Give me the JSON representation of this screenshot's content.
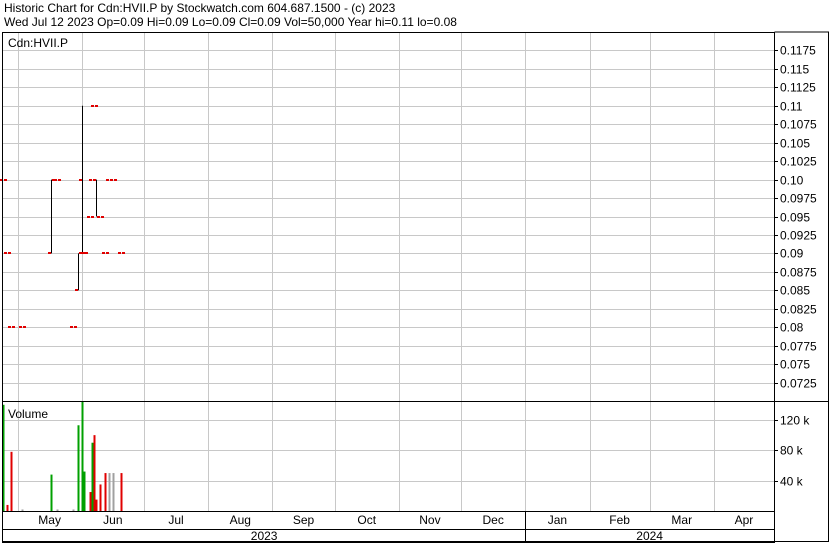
{
  "header": {
    "line1": "Historic Chart for Cdn:HVII.P by Stockwatch.com 604.687.1500 - (c) 2023",
    "line2": "Wed Jul 12 2023  Op=0.09  Hi=0.09  Lo=0.09  Cl=0.09  Vol=50,000  Year hi=0.11  lo=0.08"
  },
  "chart_data": {
    "type": "bar",
    "symbol_label": "Cdn:HVII.P",
    "volume_label": "Volume",
    "price_axis": {
      "range": [
        0.07,
        0.12
      ],
      "ticks": [
        "0.1175",
        "0.115",
        "0.1125",
        "0.11",
        "0.1075",
        "0.105",
        "0.1025",
        "0.10",
        "0.0975",
        "0.095",
        "0.0925",
        "0.09",
        "0.0875",
        "0.085",
        "0.0825",
        "0.08",
        "0.0775",
        "0.075",
        "0.0725"
      ]
    },
    "volume_axis": {
      "range": [
        0,
        145000
      ],
      "ticks": [
        {
          "label": "120 k",
          "value": 120000
        },
        {
          "label": "80 k",
          "value": 80000
        },
        {
          "label": "40 k",
          "value": 40000
        }
      ]
    },
    "x_range": [
      "2023-04-24",
      "2024-04-30"
    ],
    "months": [
      {
        "label": "May",
        "date": "2023-05-01"
      },
      {
        "label": "Jun",
        "date": "2023-06-01"
      },
      {
        "label": "Jul",
        "date": "2023-07-01"
      },
      {
        "label": "Aug",
        "date": "2023-08-01"
      },
      {
        "label": "Sep",
        "date": "2023-09-01"
      },
      {
        "label": "Oct",
        "date": "2023-10-01"
      },
      {
        "label": "Nov",
        "date": "2023-11-01"
      },
      {
        "label": "Dec",
        "date": "2023-12-01"
      },
      {
        "label": "Jan",
        "date": "2024-01-01"
      },
      {
        "label": "Feb",
        "date": "2024-02-01"
      },
      {
        "label": "Mar",
        "date": "2024-03-01"
      },
      {
        "label": "Apr",
        "date": "2024-04-01"
      }
    ],
    "years": [
      {
        "label": "2023",
        "from": "2023-04-24",
        "to": "2024-01-01"
      },
      {
        "label": "2024",
        "from": "2024-01-01",
        "to": "2024-04-30"
      }
    ],
    "bars": [
      {
        "date": "2023-04-24",
        "open": 0.1,
        "high": 0.1,
        "low": 0.1,
        "close": 0.1,
        "volume": 140000,
        "direction": "up"
      },
      {
        "date": "2023-04-26",
        "open": 0.09,
        "high": 0.09,
        "low": 0.09,
        "close": 0.09,
        "volume": 8000,
        "direction": "down"
      },
      {
        "date": "2023-04-28",
        "open": 0.08,
        "high": 0.08,
        "low": 0.08,
        "close": 0.08,
        "volume": 78000,
        "direction": "down"
      },
      {
        "date": "2023-05-03",
        "open": 0.08,
        "high": 0.08,
        "low": 0.08,
        "close": 0.08,
        "volume": 2000,
        "direction": "flat"
      },
      {
        "date": "2023-05-17",
        "open": 0.09,
        "high": 0.1,
        "low": 0.09,
        "close": 0.1,
        "volume": 48000,
        "direction": "up"
      },
      {
        "date": "2023-05-20",
        "open": 0.1,
        "high": 0.1,
        "low": 0.1,
        "close": 0.1,
        "volume": 2000,
        "direction": "flat"
      },
      {
        "date": "2023-05-28",
        "open": 0.08,
        "high": 0.08,
        "low": 0.08,
        "close": 0.08,
        "volume": 2000,
        "direction": "flat"
      },
      {
        "date": "2023-05-30",
        "open": 0.085,
        "high": 0.09,
        "low": 0.085,
        "close": 0.09,
        "volume": 113000,
        "direction": "up"
      },
      {
        "date": "2023-06-01",
        "open": 0.1,
        "high": 0.11,
        "low": 0.09,
        "close": 0.09,
        "volume": 145000,
        "direction": "up"
      },
      {
        "date": "2023-06-02",
        "open": 0.09,
        "high": 0.09,
        "low": 0.09,
        "close": 0.09,
        "volume": 52000,
        "direction": "up"
      },
      {
        "date": "2023-06-05",
        "open": 0.095,
        "high": 0.095,
        "low": 0.095,
        "close": 0.095,
        "volume": 25000,
        "direction": "down"
      },
      {
        "date": "2023-06-06",
        "open": 0.1,
        "high": 0.1,
        "low": 0.1,
        "close": 0.1,
        "volume": 90000,
        "direction": "up"
      },
      {
        "date": "2023-06-07",
        "open": 0.11,
        "high": 0.11,
        "low": 0.11,
        "close": 0.11,
        "volume": 100000,
        "direction": "down"
      },
      {
        "date": "2023-06-08",
        "open": 0.1,
        "high": 0.1,
        "low": 0.095,
        "close": 0.095,
        "volume": 15000,
        "direction": "down"
      },
      {
        "date": "2023-06-10",
        "open": 0.095,
        "high": 0.095,
        "low": 0.095,
        "close": 0.095,
        "volume": 35000,
        "direction": "down"
      },
      {
        "date": "2023-06-12",
        "open": 0.09,
        "high": 0.09,
        "low": 0.09,
        "close": 0.09,
        "volume": 50000,
        "direction": "down"
      },
      {
        "date": "2023-06-14",
        "open": 0.1,
        "high": 0.1,
        "low": 0.1,
        "close": 0.1,
        "volume": 50000,
        "direction": "flat"
      },
      {
        "date": "2023-06-16",
        "open": 0.1,
        "high": 0.1,
        "low": 0.1,
        "close": 0.1,
        "volume": 50000,
        "direction": "flat"
      },
      {
        "date": "2023-06-20",
        "open": 0.09,
        "high": 0.09,
        "low": 0.09,
        "close": 0.09,
        "volume": 50000,
        "direction": "down"
      }
    ],
    "colors": {
      "up": "#00a000",
      "down": "#e00000",
      "flat": "#a0a0a0",
      "tick": "#e00000",
      "grid": "#c8c8c8",
      "frame": "#000000"
    },
    "grid": true,
    "legend": "none"
  }
}
